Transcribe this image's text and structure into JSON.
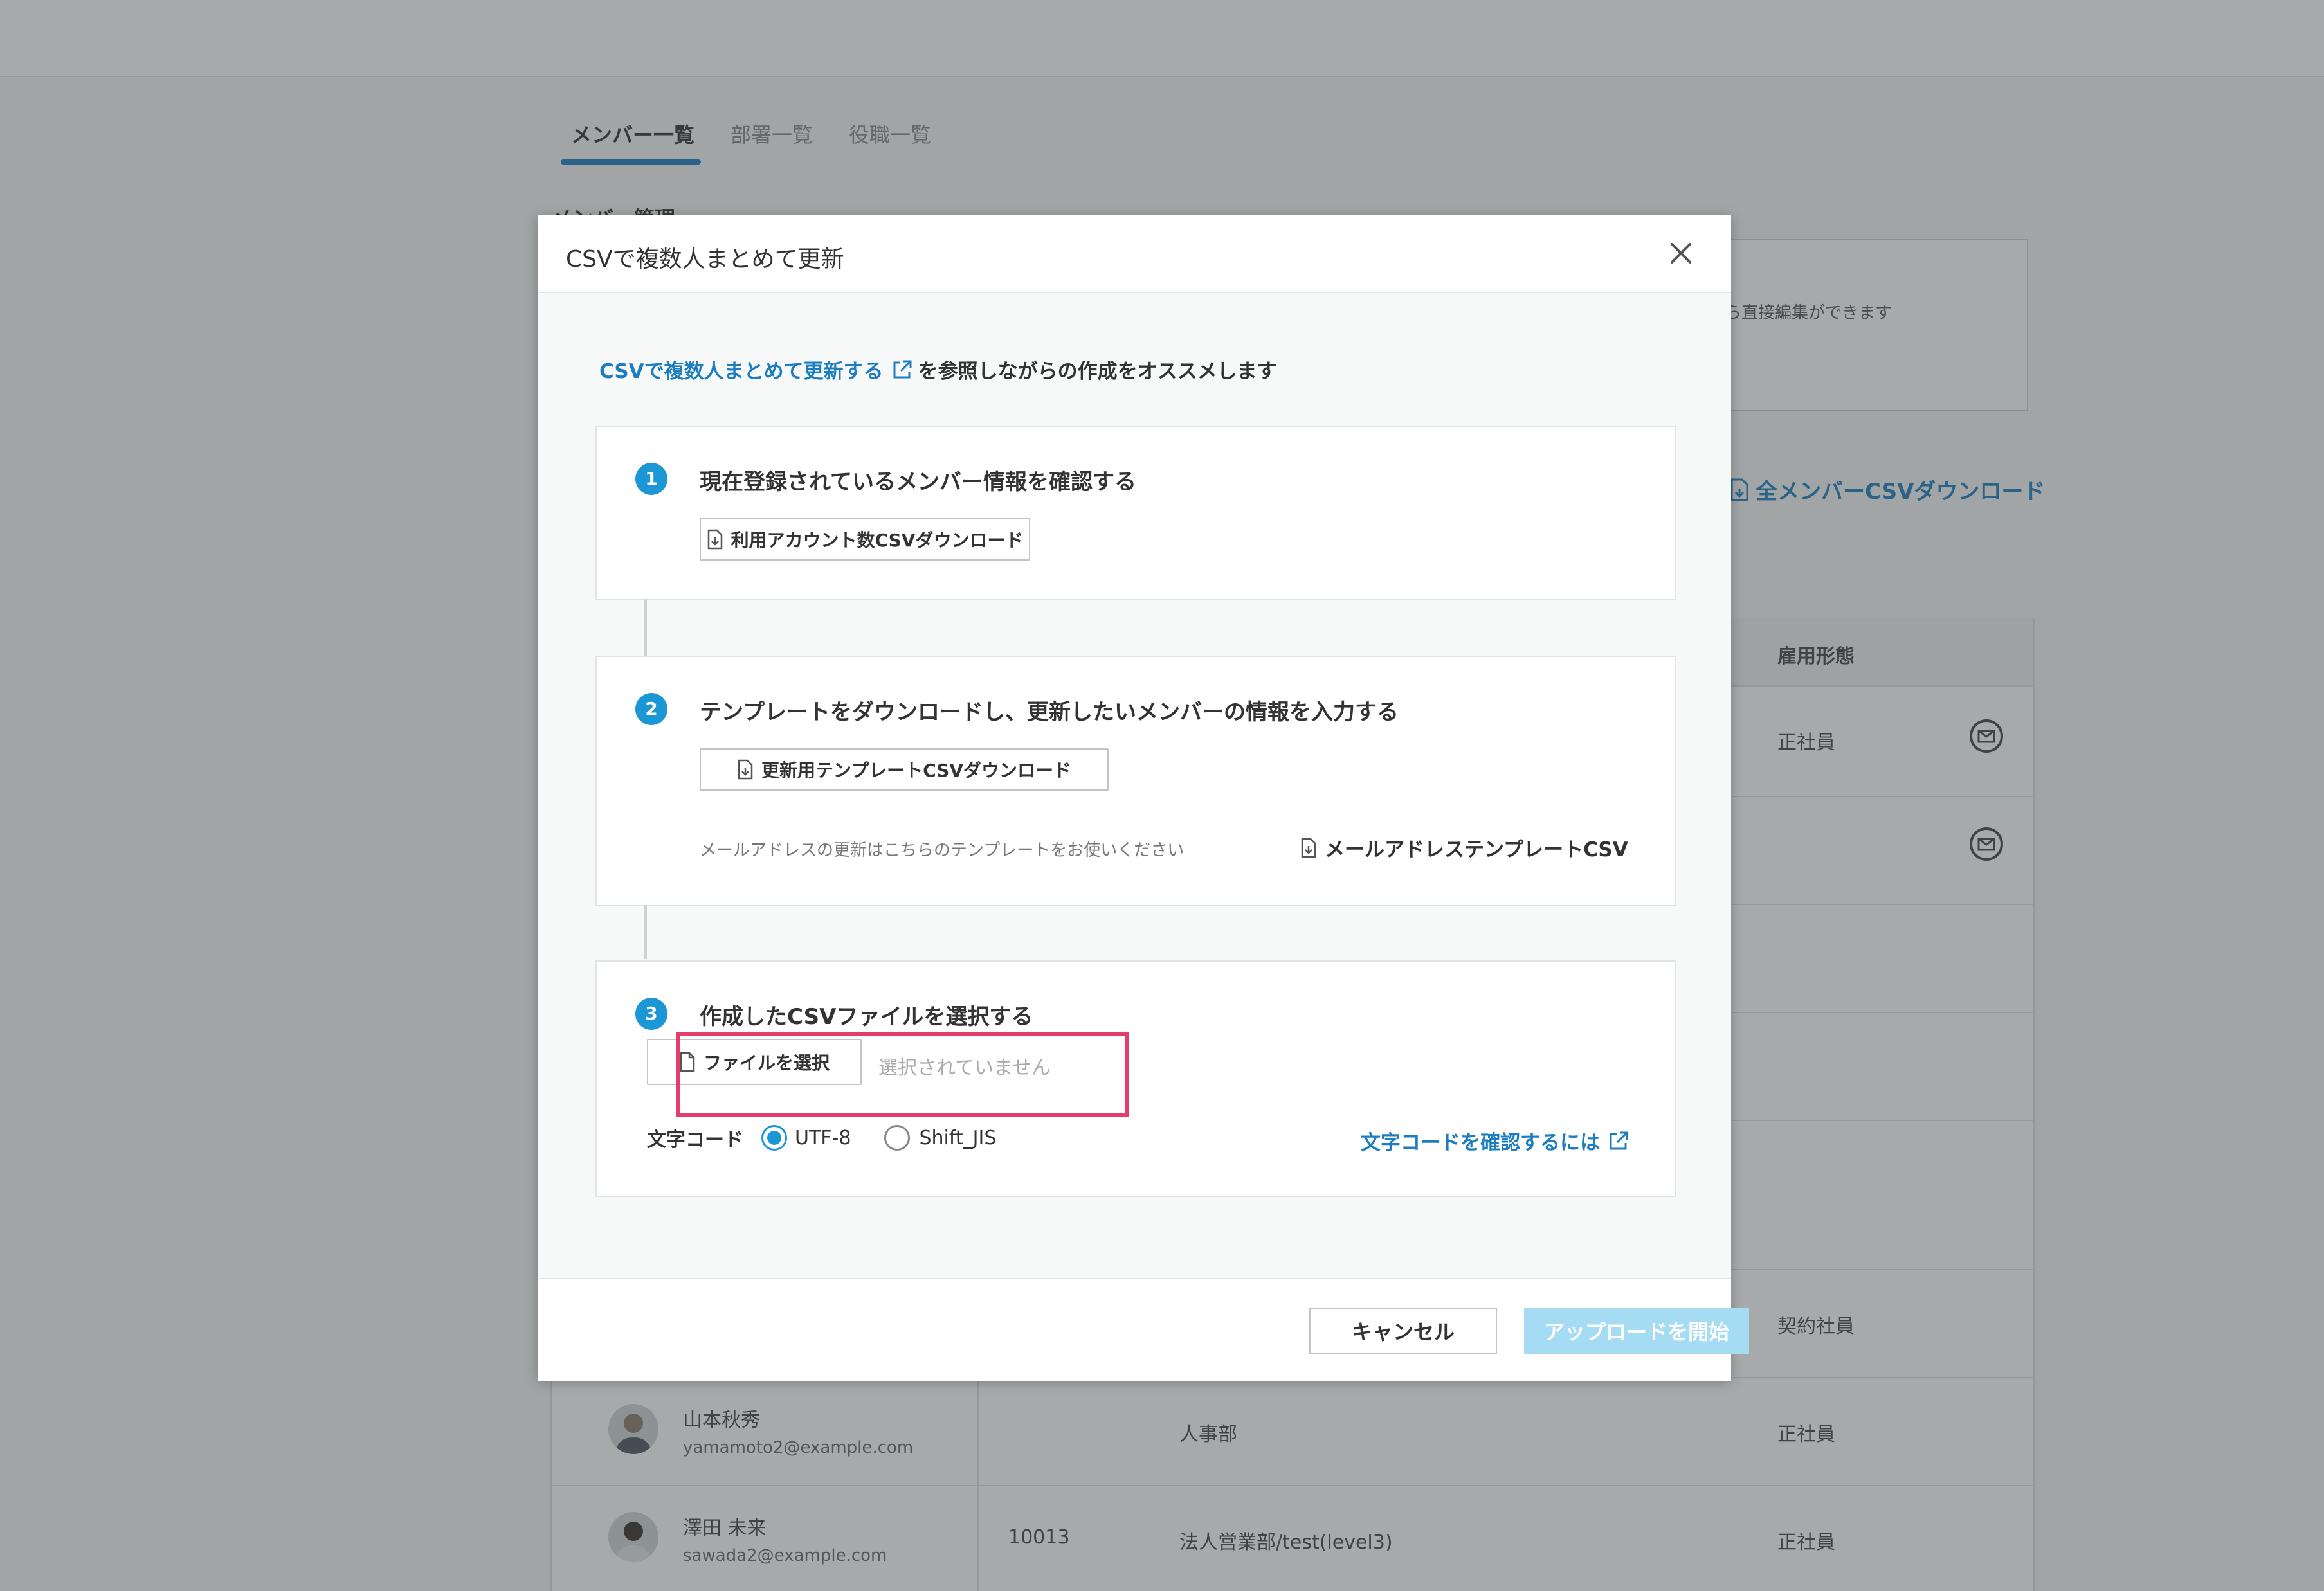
{
  "background": {
    "tabs": [
      {
        "label": "メンバー一覧"
      },
      {
        "label": "部署一覧"
      },
      {
        "label": "役職一覧"
      }
    ],
    "section_title": "メンバー管理",
    "info_text": "ら直接編集ができます",
    "all_download_label": "全メンバーCSVダウンロード",
    "table": {
      "employment_header": "雇用形態",
      "rows": [
        {
          "employment": "正社員"
        },
        {
          "employment": ""
        },
        {
          "employment": "契約社員"
        },
        {
          "name": "山本秋秀",
          "email": "yamamoto2@example.com",
          "id": "",
          "department": "人事部",
          "employment": "正社員"
        },
        {
          "name": "澤田 未来",
          "email": "sawada2@example.com",
          "id": "10013",
          "department": "法人営業部/test(level3)",
          "employment": "正社員"
        }
      ]
    }
  },
  "modal": {
    "title": "CSVで複数人まとめて更新",
    "ref_link": "CSVで複数人まとめて更新する",
    "ref_suffix": "を参照しながらの作成をオススメします",
    "steps": [
      {
        "num": "1",
        "title": "現在登録されているメンバー情報を確認する",
        "button": "利用アカウント数CSVダウンロード"
      },
      {
        "num": "2",
        "title": "テンプレートをダウンロードし、更新したいメンバーの情報を入力する",
        "button": "更新用テンプレートCSVダウンロード",
        "hint": "メールアドレスの更新はこちらのテンプレートをお使いください",
        "mail_template_link": "メールアドレステンプレートCSV"
      },
      {
        "num": "3",
        "title": "作成したCSVファイルを選択する",
        "file_button": "ファイルを選択",
        "file_status": "選択されていません",
        "charset_label": "文字コード",
        "charset_options": [
          "UTF-8",
          "Shift_JIS"
        ],
        "charset_selected": "UTF-8",
        "charset_link": "文字コードを確認するには"
      }
    ],
    "cancel_label": "キャンセル",
    "upload_label": "アップロードを開始"
  },
  "colors": {
    "accent": "#1b97d6",
    "link": "#1c7ec0",
    "highlight": "#e53d6b",
    "upload_disabled": "#a6dcf3"
  }
}
